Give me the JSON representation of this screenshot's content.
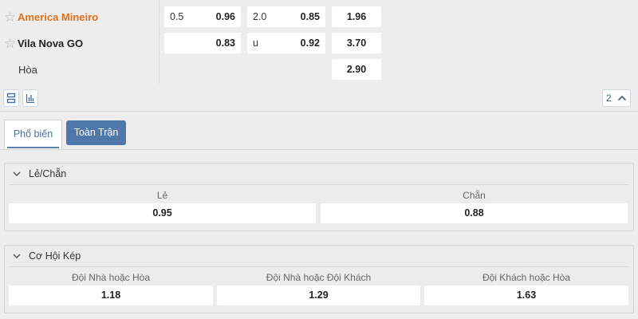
{
  "match": {
    "home": {
      "name": "America Mineiro",
      "star_icon": "star-outline-icon",
      "handicap_line": "0.5",
      "handicap_odds": "0.96",
      "total_line": "2.0",
      "total_odds": "0.85",
      "win_odds": "1.96"
    },
    "away": {
      "name": "Vila Nova GO",
      "star_icon": "star-outline-icon",
      "handicap_odds": "0.83",
      "total_line": "u",
      "total_odds": "0.92",
      "win_odds": "3.70"
    },
    "draw": {
      "label": "Hòa",
      "odds": "2.90"
    },
    "home_color": "#e2701a"
  },
  "toolbar": {
    "list_icon": "list-view-icon",
    "chart_icon": "bar-chart-icon",
    "counter": "2",
    "counter_icon": "chevron-up-icon"
  },
  "tabs": [
    {
      "label": "Phổ biến",
      "active": true
    },
    {
      "label": "Toàn Trận",
      "active": false
    }
  ],
  "markets": {
    "odd_even": {
      "title": "Lẻ/Chẵn",
      "options": [
        {
          "label": "Lẻ",
          "odds": "0.95"
        },
        {
          "label": "Chẵn",
          "odds": "0.88"
        }
      ]
    },
    "double_chance": {
      "title": "Cơ Hội Kép",
      "options": [
        {
          "label": "Đội Nhà hoặc Hòa",
          "odds": "1.18"
        },
        {
          "label": "Đội Nhà hoặc Đội Khách",
          "odds": "1.29"
        },
        {
          "label": "Đội Khách hoặc Hòa",
          "odds": "1.63"
        }
      ]
    }
  },
  "colors": {
    "accent": "#4f78aa",
    "background": "#ededed"
  }
}
